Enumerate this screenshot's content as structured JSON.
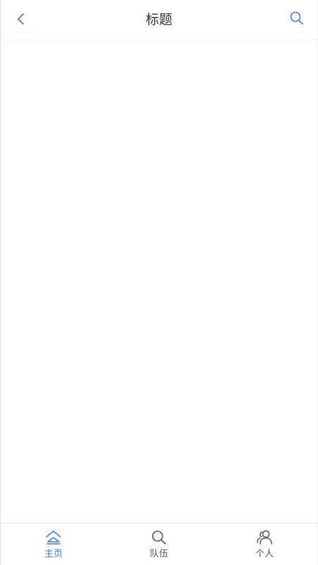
{
  "header": {
    "title": "标题",
    "back_icon": "chevron-left-icon",
    "search_icon": "search-icon"
  },
  "tabbar": {
    "tabs": [
      {
        "label": "主页",
        "icon": "home-icon",
        "active": true
      },
      {
        "label": "队伍",
        "icon": "search-icon",
        "active": false
      },
      {
        "label": "个人",
        "icon": "user-group-icon",
        "active": false
      }
    ]
  },
  "colors": {
    "accent": "#3b7be0",
    "inactive": "#555555",
    "title": "#333333",
    "divider": "#efefef"
  }
}
